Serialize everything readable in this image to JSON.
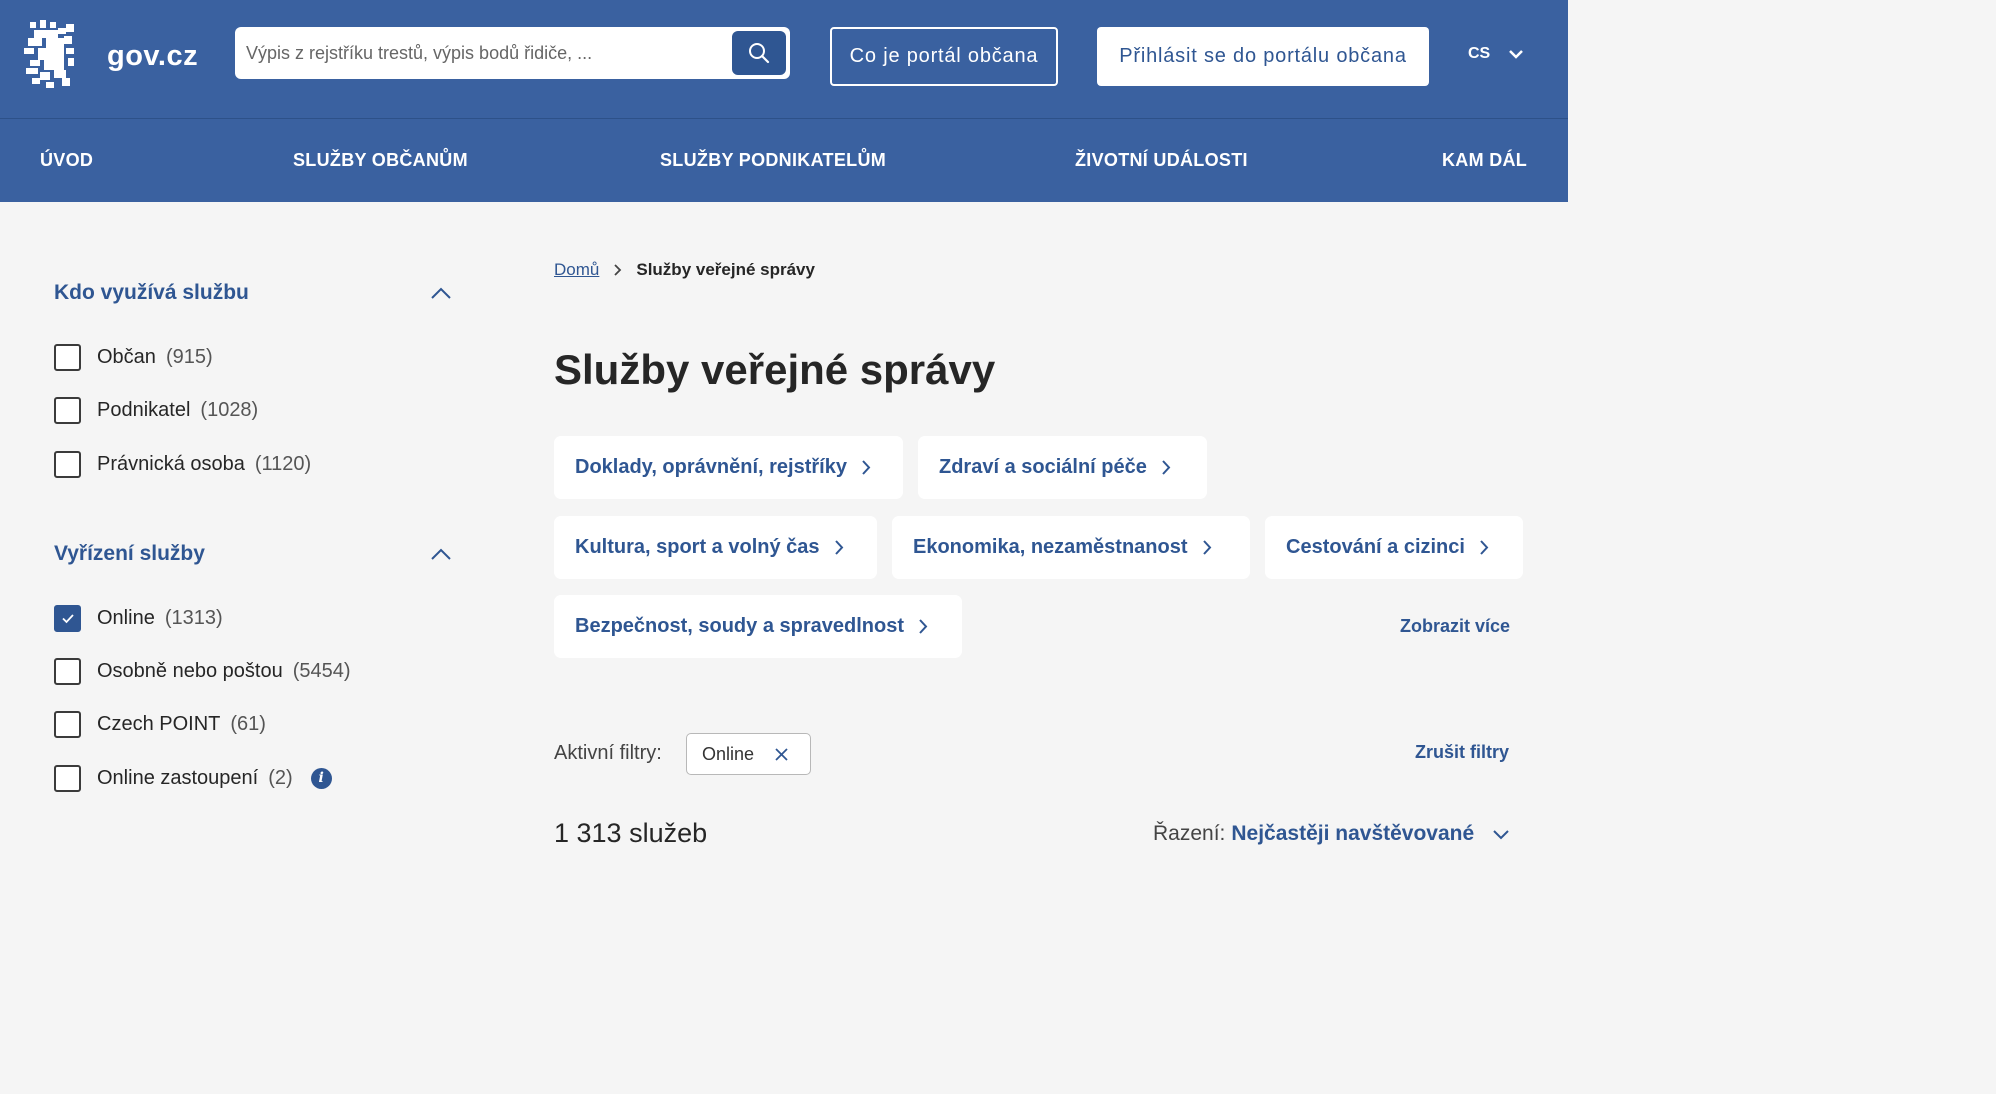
{
  "header": {
    "brand": "gov.cz",
    "search_placeholder": "Výpis z rejstříku trestů, výpis bodů řidiče, ...",
    "about_button": "Co je portál občana",
    "login_button": "Přihlásit se do portálu občana",
    "language": "CS"
  },
  "nav": {
    "items": [
      "ÚVOD",
      "SLUŽBY OBČANŮM",
      "SLUŽBY PODNIKATELŮM",
      "ŽIVOTNÍ UDÁLOSTI",
      "KAM DÁL"
    ]
  },
  "sidebar": {
    "groups": [
      {
        "title": "Kdo využívá službu",
        "options": [
          {
            "label": "Občan",
            "count": "(915)",
            "checked": false
          },
          {
            "label": "Podnikatel",
            "count": "(1028)",
            "checked": false
          },
          {
            "label": "Právnická osoba",
            "count": "(1120)",
            "checked": false
          }
        ]
      },
      {
        "title": "Vyřízení služby",
        "options": [
          {
            "label": "Online",
            "count": "(1313)",
            "checked": true
          },
          {
            "label": "Osobně nebo poštou",
            "count": "(5454)",
            "checked": false
          },
          {
            "label": "Czech POINT",
            "count": "(61)",
            "checked": false
          },
          {
            "label": "Online zastoupení",
            "count": "(2)",
            "checked": false,
            "info": "i"
          }
        ]
      }
    ]
  },
  "main": {
    "breadcrumb": {
      "home": "Domů",
      "current": "Služby veřejné správy"
    },
    "title": "Služby veřejné správy",
    "categories": [
      "Doklady, oprávnění, rejstříky",
      "Zdraví a sociální péče",
      "Kultura, sport a volný čas",
      "Ekonomika, nezaměstnanost",
      "Cestování a cizinci",
      "Bezpečnost, soudy a spravedlnost"
    ],
    "show_more": "Zobrazit více",
    "active_filters_label": "Aktivní filtry:",
    "active_filters": [
      "Online"
    ],
    "clear_filters": "Zrušit filtry",
    "result_count": "1 313 služeb",
    "sort_label": "Řazení:",
    "sort_value": "Nejčastěji navštěvované"
  },
  "colors": {
    "primary": "#3a61a0",
    "accent": "#2f5692",
    "background": "#f5f5f5"
  }
}
